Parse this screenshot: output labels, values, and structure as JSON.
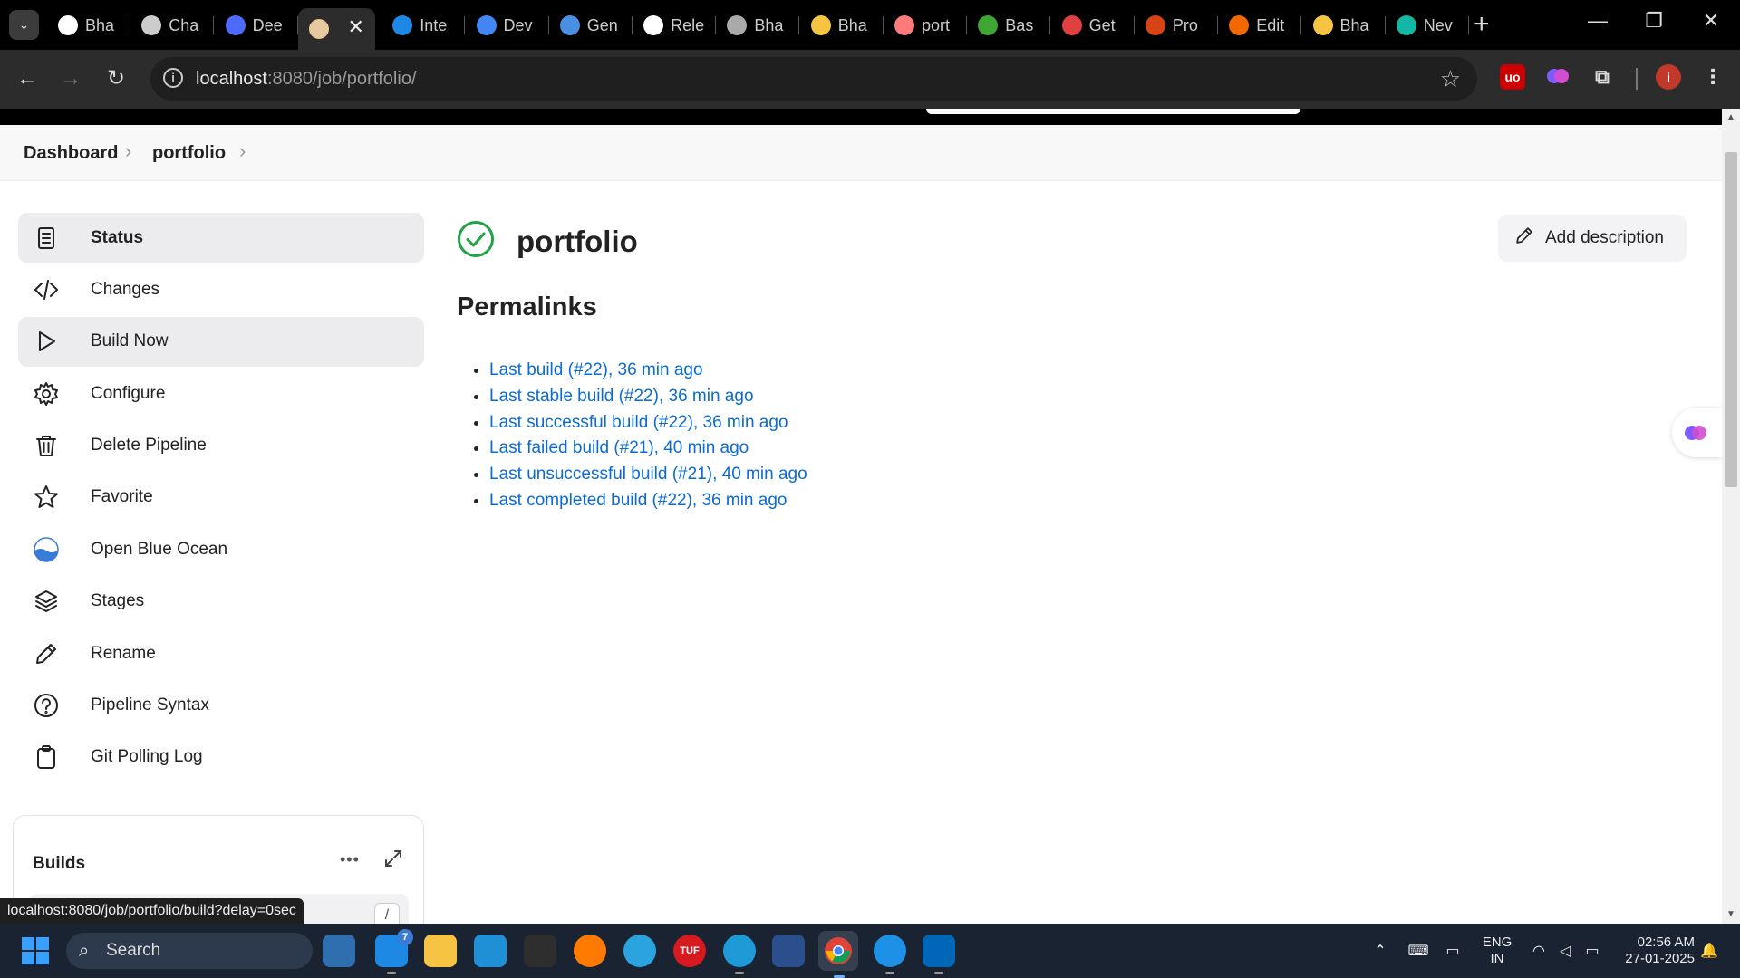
{
  "browser": {
    "tabs": [
      {
        "label": "Bha",
        "icon": "github-icon",
        "color": "#ffffff"
      },
      {
        "label": "Cha",
        "icon": "chatgpt-icon",
        "color": "#cccccc"
      },
      {
        "label": "Dee",
        "icon": "deepseek-icon",
        "color": "#4d6bfe"
      },
      {
        "label": "",
        "icon": "avatar-icon",
        "color": "#e8c8a0",
        "active": true
      },
      {
        "label": "Inte",
        "icon": "is-icon",
        "color": "#1e88e5"
      },
      {
        "label": "Dev",
        "icon": "docs-icon",
        "color": "#4285f4"
      },
      {
        "label": "Gen",
        "icon": "gemini-icon",
        "color": "#4a90e2"
      },
      {
        "label": "Rele",
        "icon": "github-icon",
        "color": "#ffffff"
      },
      {
        "label": "Bha",
        "icon": "globe-icon",
        "color": "#aaaaaa"
      },
      {
        "label": "Bha",
        "icon": "slash-icon",
        "color": "#f5c542"
      },
      {
        "label": "port",
        "icon": "portfolio-icon",
        "color": "#ff7b7b"
      },
      {
        "label": "Bas",
        "icon": "b64-icon",
        "color": "#3fa535"
      },
      {
        "label": "Get",
        "icon": "face-icon",
        "color": "#e04040"
      },
      {
        "label": "Pro",
        "icon": "fire-icon",
        "color": "#d84315"
      },
      {
        "label": "Edit",
        "icon": "grafana-icon",
        "color": "#f46800"
      },
      {
        "label": "Bha",
        "icon": "slash-icon",
        "color": "#f5c542"
      },
      {
        "label": "Nev",
        "icon": "m-icon",
        "color": "#12b8a6"
      }
    ],
    "tab_close_glyph": "✕",
    "new_tab_glyph": "+",
    "url_host": "localhost",
    "url_rest": ":8080/job/portfolio/",
    "profile_initial": "i"
  },
  "breadcrumb": {
    "items": [
      "Dashboard",
      "portfolio"
    ],
    "separator": "›"
  },
  "sidebar": {
    "items": [
      {
        "label": "Status",
        "icon": "status-icon"
      },
      {
        "label": "Changes",
        "icon": "code-icon"
      },
      {
        "label": "Build Now",
        "icon": "play-icon"
      },
      {
        "label": "Configure",
        "icon": "gear-icon"
      },
      {
        "label": "Delete Pipeline",
        "icon": "trash-icon"
      },
      {
        "label": "Favorite",
        "icon": "star-icon"
      },
      {
        "label": "Open Blue Ocean",
        "icon": "blue-ocean-icon"
      },
      {
        "label": "Stages",
        "icon": "layers-icon"
      },
      {
        "label": "Rename",
        "icon": "pencil-icon"
      },
      {
        "label": "Pipeline Syntax",
        "icon": "help-icon"
      },
      {
        "label": "Git Polling Log",
        "icon": "clipboard-icon"
      }
    ]
  },
  "builds": {
    "title": "Builds",
    "more_glyph": "•••",
    "filter_shortcut": "/"
  },
  "main": {
    "job_name": "portfolio",
    "add_description": "Add description",
    "permalinks_heading": "Permalinks",
    "permalinks": [
      "Last build (#22), 36 min ago",
      "Last stable build (#22), 36 min ago",
      "Last successful build (#22), 36 min ago",
      "Last failed build (#21), 40 min ago",
      "Last unsuccessful build (#21), 40 min ago",
      "Last completed build (#22), 36 min ago"
    ]
  },
  "status_bar_url": "localhost:8080/job/portfolio/build?delay=0sec",
  "taskbar": {
    "search_label": "Search",
    "mail_badge": "7",
    "tuf_label": "TUF",
    "language": "ENG",
    "region": "IN",
    "time": "02:56 AM",
    "date": "27-01-2025"
  },
  "colors": {
    "success": "#1ea446",
    "link": "#0b6bd4",
    "accent_blue": "#3aa0ff"
  }
}
